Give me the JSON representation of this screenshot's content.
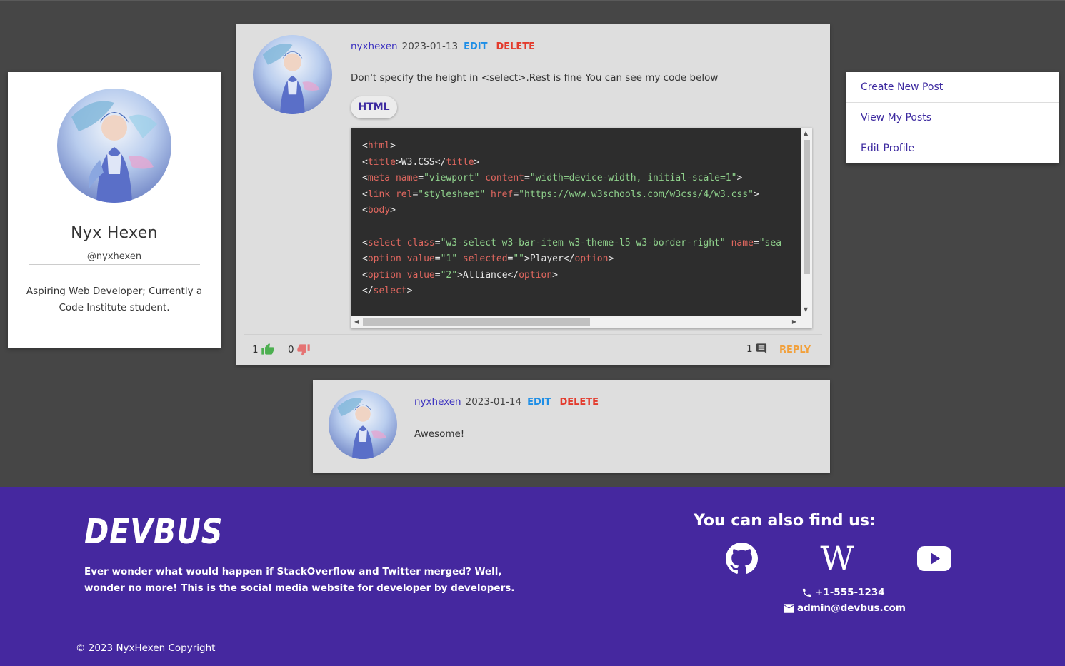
{
  "profile": {
    "name": "Nyx Hexen",
    "handle": "@nyxhexen",
    "bio": "Aspiring Web Developer; Currently a Code Institute student."
  },
  "menu": {
    "items": [
      {
        "label": "Create New Post"
      },
      {
        "label": "View My Posts"
      },
      {
        "label": "Edit Profile"
      }
    ]
  },
  "post": {
    "author": "nyxhexen",
    "date": "2023-01-13",
    "edit_label": "EDIT",
    "delete_label": "DELETE",
    "body": "Don't specify the height in <select>.Rest is fine You can see my code below",
    "tag": "HTML",
    "code_lines": [
      "<html>",
      "<title>W3.CSS</title>",
      "<meta name=\"viewport\" content=\"width=device-width, initial-scale=1\">",
      "<link rel=\"stylesheet\" href=\"https://www.w3schools.com/w3css/4/w3.css\">",
      "<body>",
      "",
      "<select class=\"w3-select w3-bar-item w3-theme-l5 w3-border-right\" name=\"sea",
      "<option value=\"1\" selected=\"\">Player</option>",
      "<option value=\"2\">Alliance</option>",
      "</select>"
    ],
    "likes": "1",
    "dislikes": "0",
    "comments": "1",
    "reply_label": "REPLY"
  },
  "reply": {
    "author": "nyxhexen",
    "date": "2023-01-14",
    "edit_label": "EDIT",
    "delete_label": "DELETE",
    "body": "Awesome!"
  },
  "footer": {
    "logo": "DEVBUS",
    "tagline": "Ever wonder what would happen if StackOverflow and Twitter merged? Well, wonder no more! This is the social media website for developer by developers.",
    "find_us": "You can also find us:",
    "phone": "+1-555-1234",
    "email": "admin@devbus.com",
    "copyright": "© 2023 NyxHexen Copyright",
    "social_icons": [
      "github-icon",
      "wikipedia-icon",
      "youtube-icon"
    ]
  },
  "colors": {
    "background": "#464646",
    "brand": "#45289f",
    "edit": "#1e8ee6",
    "delete": "#e33b2d",
    "reply": "#f2a03a",
    "like": "#4caf50",
    "dislike": "#e57373"
  }
}
